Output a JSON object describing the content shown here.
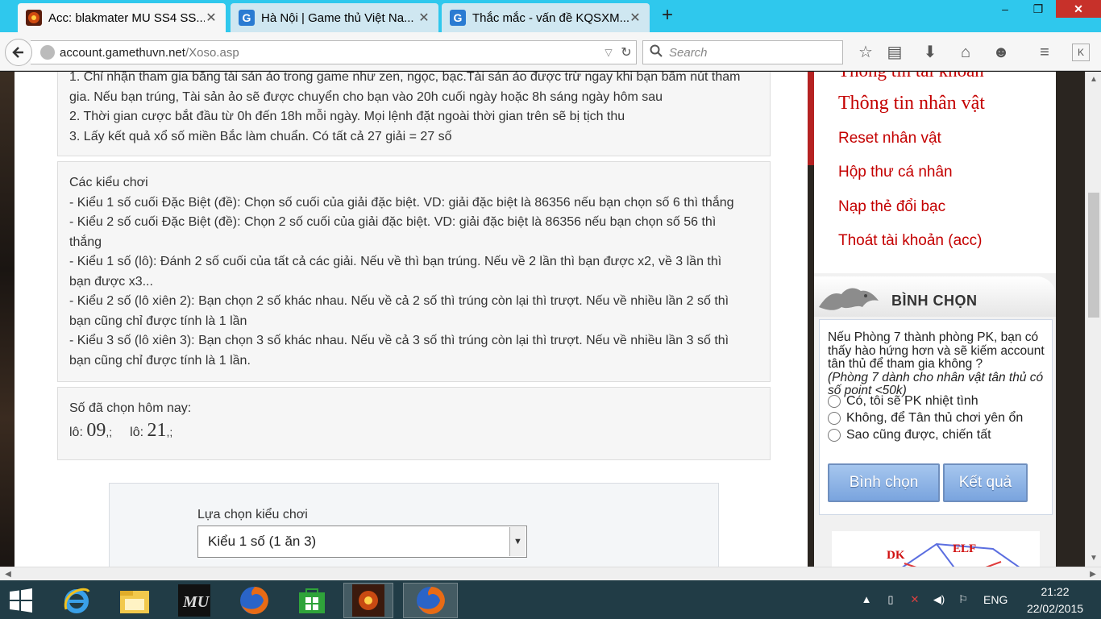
{
  "browser": {
    "tabs": [
      {
        "title": "Acc: blakmater MU SS4 SS...",
        "close": "✕"
      },
      {
        "title": "Hà Nội | Game thủ Việt Na...",
        "close": "✕"
      },
      {
        "title": "Thắc mắc - vấn đề KQSXM...",
        "close": "✕"
      }
    ],
    "new_tab": "+",
    "url_host": "account.gamethuvn.net",
    "url_path": "/Xoso.asp",
    "search_placeholder": "Search",
    "window_controls": {
      "minimize": "–",
      "maximize": "❐",
      "close": "✕"
    }
  },
  "rules": {
    "lines": [
      "1. Chỉ nhận tham gia bằng tài sản ảo trong game như zen, ngọc, bạc.Tài sản ảo được trừ ngay khi bạn bấm nút tham",
      "gia. Nếu bạn trúng, Tài sản ảo sẽ được chuyển cho bạn vào 20h cuối ngày hoặc 8h sáng ngày hôm sau",
      "2. Thời gian cược bắt đầu từ 0h đến 18h mỗi ngày. Mọi lệnh đặt ngoài thời gian trên sẽ bị tịch thu",
      "3. Lấy kết quả xổ số miền Bắc làm chuẩn. Có tất cả 27 giải = 27 số"
    ]
  },
  "play_types": {
    "heading": "Các kiểu chơi",
    "lines": [
      "- Kiểu 1 số cuối Đặc Biệt (đề): Chọn số cuối của giải đặc biệt. VD: giải đặc biệt là 86356 nếu bạn chọn số 6 thì thắng",
      "- Kiểu 2 số cuối Đặc Biệt (đề): Chọn 2 số cuối của giải đặc biệt. VD: giải đặc biệt là 86356 nếu bạn chọn số 56 thì",
      "thắng",
      "- Kiểu 1 số (lô): Đánh 2 số cuối của tất cả các giải. Nếu về thì bạn trúng. Nếu về 2 lần thì bạn được x2, về 3 lần thì",
      "bạn được x3...",
      "- Kiểu 2 số (lô xiên 2): Bạn chọn 2 số khác nhau. Nếu về cả 2 số thì trúng còn lại thì trượt. Nếu về nhiều lần 2 số thì",
      "bạn cũng chỉ được tính là 1 lần",
      "- Kiểu 3 số (lô xiên 3): Bạn chọn 3 số khác nhau. Nếu về cả 3 số thì trúng còn lại thì trượt. Nếu về nhiều lần 3 số thì",
      "bạn cũng chỉ được tính là 1 lần."
    ]
  },
  "picked_today": {
    "heading": "Số đã chọn hôm nay:",
    "items": [
      {
        "label": "lô:",
        "number": "09",
        "sep": ",;"
      },
      {
        "label": "lô:",
        "number": "21",
        "sep": ",;"
      }
    ]
  },
  "bet_form": {
    "label": "Lựa chọn kiểu chơi",
    "selected": "Kiểu 1 số (1 ăn 3)"
  },
  "right_menu": {
    "partial_top": "Thông tin tài khoản",
    "items": [
      "Thông tin nhân vật",
      "Reset nhân vật",
      "Hộp thư cá nhân",
      "Nạp thẻ đổi bạc",
      "Thoát tài khoản (acc)"
    ]
  },
  "poll": {
    "title": "BÌNH CHỌN",
    "question": "Nếu Phòng 7 thành phòng PK, bạn có thấy hào hứng hơn và sẽ kiếm account tân thủ để tham gia không ?",
    "note": "(Phòng 7 dành cho nhân vật tân thủ có số point <50k)",
    "options": [
      "Có, tôi sẽ PK nhiệt tình",
      "Không, để Tân thủ chơi yên ổn",
      "Sao cũng được, chiến tất"
    ],
    "vote_button": "Bình chọn",
    "result_button": "Kết quả",
    "map_labels": [
      "DK",
      "ELF"
    ]
  },
  "taskbar": {
    "language": "ENG",
    "time": "21:22",
    "date": "22/02/2015"
  },
  "colors": {
    "titlebar": "#2fc8ed",
    "menu_red": "#c40000",
    "taskbar": "#213c46",
    "poll_button": "#7aa4de"
  }
}
